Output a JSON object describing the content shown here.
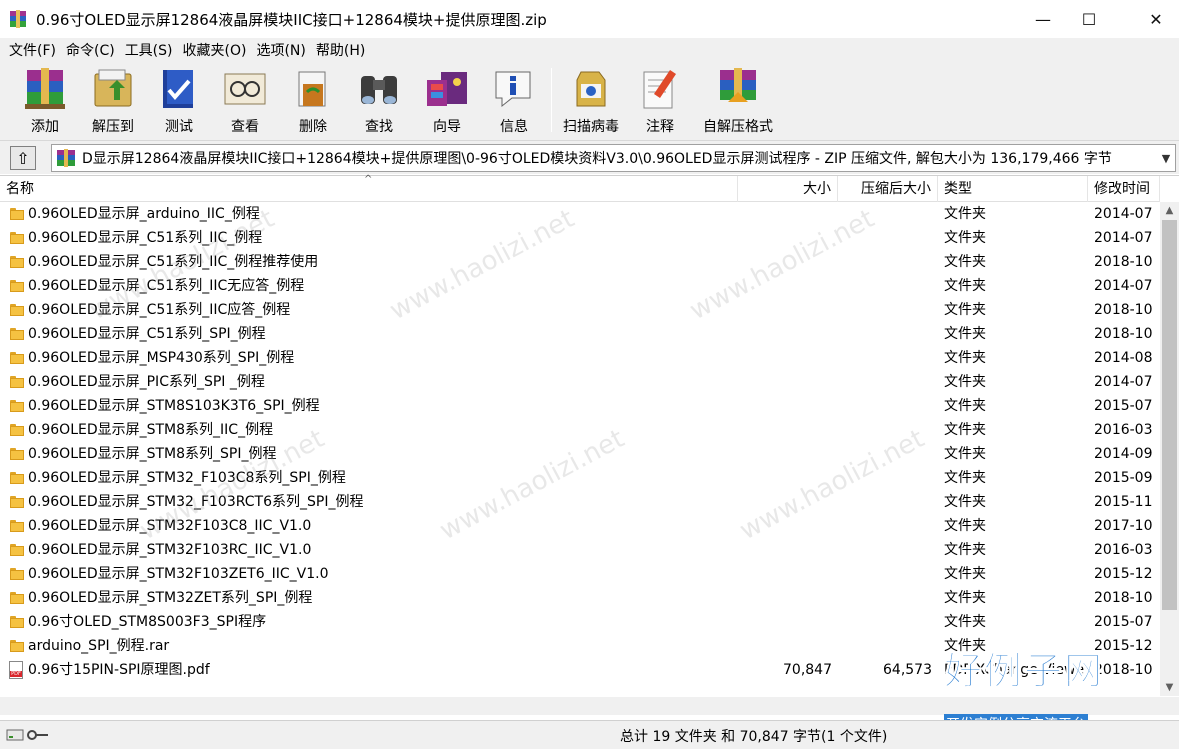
{
  "window": {
    "title": "0.96寸OLED显示屏12864液晶屏模块IIC接口+12864模块+提供原理图.zip",
    "minimize_glyph": "—",
    "maximize_glyph": "☐",
    "close_glyph": "✕"
  },
  "menu": [
    "文件(F)",
    "命令(C)",
    "工具(S)",
    "收藏夹(O)",
    "选项(N)",
    "帮助(H)"
  ],
  "toolbar": [
    {
      "label": "添加",
      "icon": "add-archive-icon"
    },
    {
      "label": "解压到",
      "icon": "extract-to-icon"
    },
    {
      "label": "测试",
      "icon": "test-icon"
    },
    {
      "label": "查看",
      "icon": "view-icon"
    },
    {
      "label": "删除",
      "icon": "delete-icon"
    },
    {
      "label": "查找",
      "icon": "find-icon"
    },
    {
      "label": "向导",
      "icon": "wizard-icon"
    },
    {
      "label": "信息",
      "icon": "info-icon"
    },
    {
      "label": "扫描病毒",
      "icon": "virus-scan-icon"
    },
    {
      "label": "注释",
      "icon": "comment-icon"
    },
    {
      "label": "自解压格式",
      "icon": "sfx-icon"
    }
  ],
  "address": {
    "up_glyph": "⇧",
    "path": "D显示屏12864液晶屏模块IIC接口+12864模块+提供原理图\\0-96寸OLED模块资料V3.0\\0.96OLED显示屏测试程序 - ZIP 压缩文件, 解包大小为 136,179,466 字节"
  },
  "columns": {
    "name": "名称",
    "size": "大小",
    "packed": "压缩后大小",
    "type": "类型",
    "modified": "修改时间"
  },
  "files": [
    {
      "name": "0.96OLED显示屏_arduino_IIC_例程",
      "size": "",
      "packed": "",
      "type": "文件夹",
      "modified": "2014-07",
      "kind": "folder"
    },
    {
      "name": "0.96OLED显示屏_C51系列_IIC_例程",
      "size": "",
      "packed": "",
      "type": "文件夹",
      "modified": "2014-07",
      "kind": "folder"
    },
    {
      "name": "0.96OLED显示屏_C51系列_IIC_例程推荐使用",
      "size": "",
      "packed": "",
      "type": "文件夹",
      "modified": "2018-10",
      "kind": "folder"
    },
    {
      "name": "0.96OLED显示屏_C51系列_IIC无应答_例程",
      "size": "",
      "packed": "",
      "type": "文件夹",
      "modified": "2014-07",
      "kind": "folder"
    },
    {
      "name": "0.96OLED显示屏_C51系列_IIC应答_例程",
      "size": "",
      "packed": "",
      "type": "文件夹",
      "modified": "2018-10",
      "kind": "folder"
    },
    {
      "name": "0.96OLED显示屏_C51系列_SPI_例程",
      "size": "",
      "packed": "",
      "type": "文件夹",
      "modified": "2018-10",
      "kind": "folder"
    },
    {
      "name": "0.96OLED显示屏_MSP430系列_SPI_例程",
      "size": "",
      "packed": "",
      "type": "文件夹",
      "modified": "2014-08",
      "kind": "folder"
    },
    {
      "name": "0.96OLED显示屏_PIC系列_SPI _例程",
      "size": "",
      "packed": "",
      "type": "文件夹",
      "modified": "2014-07",
      "kind": "folder"
    },
    {
      "name": "0.96OLED显示屏_STM8S103K3T6_SPI_例程",
      "size": "",
      "packed": "",
      "type": "文件夹",
      "modified": "2015-07",
      "kind": "folder"
    },
    {
      "name": "0.96OLED显示屏_STM8系列_IIC_例程",
      "size": "",
      "packed": "",
      "type": "文件夹",
      "modified": "2016-03",
      "kind": "folder"
    },
    {
      "name": "0.96OLED显示屏_STM8系列_SPI_例程",
      "size": "",
      "packed": "",
      "type": "文件夹",
      "modified": "2014-09",
      "kind": "folder"
    },
    {
      "name": "0.96OLED显示屏_STM32_F103C8系列_SPI_例程",
      "size": "",
      "packed": "",
      "type": "文件夹",
      "modified": "2015-09",
      "kind": "folder"
    },
    {
      "name": "0.96OLED显示屏_STM32_F103RCT6系列_SPI_例程",
      "size": "",
      "packed": "",
      "type": "文件夹",
      "modified": "2015-11",
      "kind": "folder"
    },
    {
      "name": "0.96OLED显示屏_STM32F103C8_IIC_V1.0",
      "size": "",
      "packed": "",
      "type": "文件夹",
      "modified": "2017-10",
      "kind": "folder"
    },
    {
      "name": "0.96OLED显示屏_STM32F103RC_IIC_V1.0",
      "size": "",
      "packed": "",
      "type": "文件夹",
      "modified": "2016-03",
      "kind": "folder"
    },
    {
      "name": "0.96OLED显示屏_STM32F103ZET6_IIC_V1.0",
      "size": "",
      "packed": "",
      "type": "文件夹",
      "modified": "2015-12",
      "kind": "folder"
    },
    {
      "name": "0.96OLED显示屏_STM32ZET系列_SPI_例程",
      "size": "",
      "packed": "",
      "type": "文件夹",
      "modified": "2018-10",
      "kind": "folder"
    },
    {
      "name": "0.96寸OLED_STM8S003F3_SPI程序",
      "size": "",
      "packed": "",
      "type": "文件夹",
      "modified": "2015-07",
      "kind": "folder"
    },
    {
      "name": "arduino_SPI_例程.rar",
      "size": "",
      "packed": "",
      "type": "文件夹",
      "modified": "2015-12",
      "kind": "folder"
    },
    {
      "name": "0.96寸15PIN-SPI原理图.pdf",
      "size": "70,847",
      "packed": "64,573",
      "type": "PDF-XChange Viewer Document",
      "modified": "2018-10",
      "kind": "pdf"
    }
  ],
  "status": {
    "summary": "总计 19 文件夹 和 70,847 字节(1 个文件)"
  },
  "watermark": {
    "text": "www.haolizi.net",
    "brand_main": "好例子网",
    "brand_sub": "开发实例分享交流平台"
  }
}
